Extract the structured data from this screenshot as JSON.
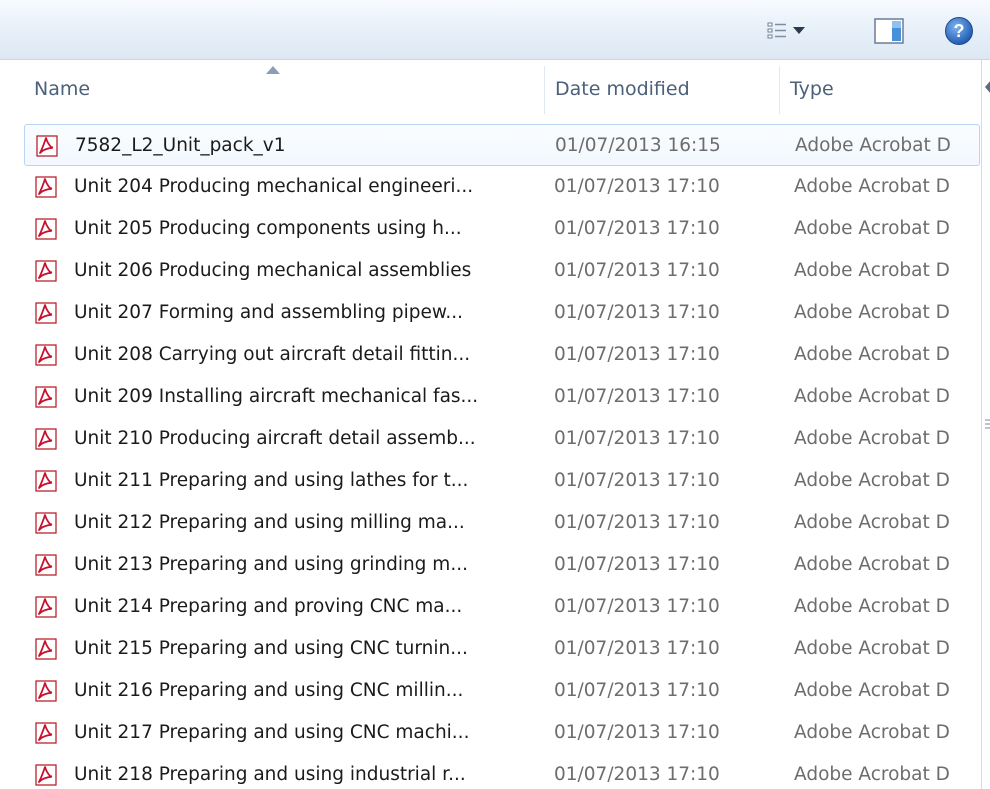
{
  "toolbar": {
    "views_icon": "view-details-icon",
    "views_caret_icon": "chevron-down-icon",
    "preview_icon": "preview-pane-icon",
    "help_icon": "help-icon",
    "help_glyph": "?"
  },
  "columns": {
    "name": "Name",
    "date_modified": "Date modified",
    "type": "Type"
  },
  "files": [
    {
      "name": "7582_L2_Unit_pack_v1",
      "date": "01/07/2013 16:15",
      "type": "Adobe Acrobat D",
      "selected": true
    },
    {
      "name": "Unit 204 Producing mechanical engineeri...",
      "date": "01/07/2013 17:10",
      "type": "Adobe Acrobat D"
    },
    {
      "name": "Unit 205 Producing components using h...",
      "date": "01/07/2013 17:10",
      "type": "Adobe Acrobat D"
    },
    {
      "name": "Unit 206 Producing mechanical assemblies",
      "date": "01/07/2013 17:10",
      "type": "Adobe Acrobat D"
    },
    {
      "name": "Unit 207 Forming and assembling pipew...",
      "date": "01/07/2013 17:10",
      "type": "Adobe Acrobat D"
    },
    {
      "name": "Unit 208 Carrying out aircraft detail fittin...",
      "date": "01/07/2013 17:10",
      "type": "Adobe Acrobat D"
    },
    {
      "name": "Unit 209 Installing aircraft mechanical fas...",
      "date": "01/07/2013 17:10",
      "type": "Adobe Acrobat D"
    },
    {
      "name": "Unit 210 Producing aircraft detail assemb...",
      "date": "01/07/2013 17:10",
      "type": "Adobe Acrobat D"
    },
    {
      "name": "Unit 211 Preparing and using lathes for t...",
      "date": "01/07/2013 17:10",
      "type": "Adobe Acrobat D"
    },
    {
      "name": "Unit 212 Preparing and using milling ma...",
      "date": "01/07/2013 17:10",
      "type": "Adobe Acrobat D"
    },
    {
      "name": "Unit 213 Preparing and using grinding m...",
      "date": "01/07/2013 17:10",
      "type": "Adobe Acrobat D"
    },
    {
      "name": "Unit 214 Preparing and proving CNC ma...",
      "date": "01/07/2013 17:10",
      "type": "Adobe Acrobat D"
    },
    {
      "name": "Unit 215 Preparing and using CNC turnin...",
      "date": "01/07/2013 17:10",
      "type": "Adobe Acrobat D"
    },
    {
      "name": "Unit 216 Preparing and using CNC millin...",
      "date": "01/07/2013 17:10",
      "type": "Adobe Acrobat D"
    },
    {
      "name": "Unit 217 Preparing and using CNC machi...",
      "date": "01/07/2013 17:10",
      "type": "Adobe Acrobat D"
    },
    {
      "name": "Unit 218 Preparing and using industrial r...",
      "date": "01/07/2013 17:10",
      "type": "Adobe Acrobat D"
    }
  ],
  "file_icon": "pdf-file-icon",
  "colors": {
    "toolbar_top": "#f7fbff",
    "toolbar_bottom": "#dde8f4",
    "header_text": "#4c607a",
    "selection_border": "#b9d5ef",
    "pdf_red": "#c8102e",
    "help_blue": "#2f6fc9"
  }
}
